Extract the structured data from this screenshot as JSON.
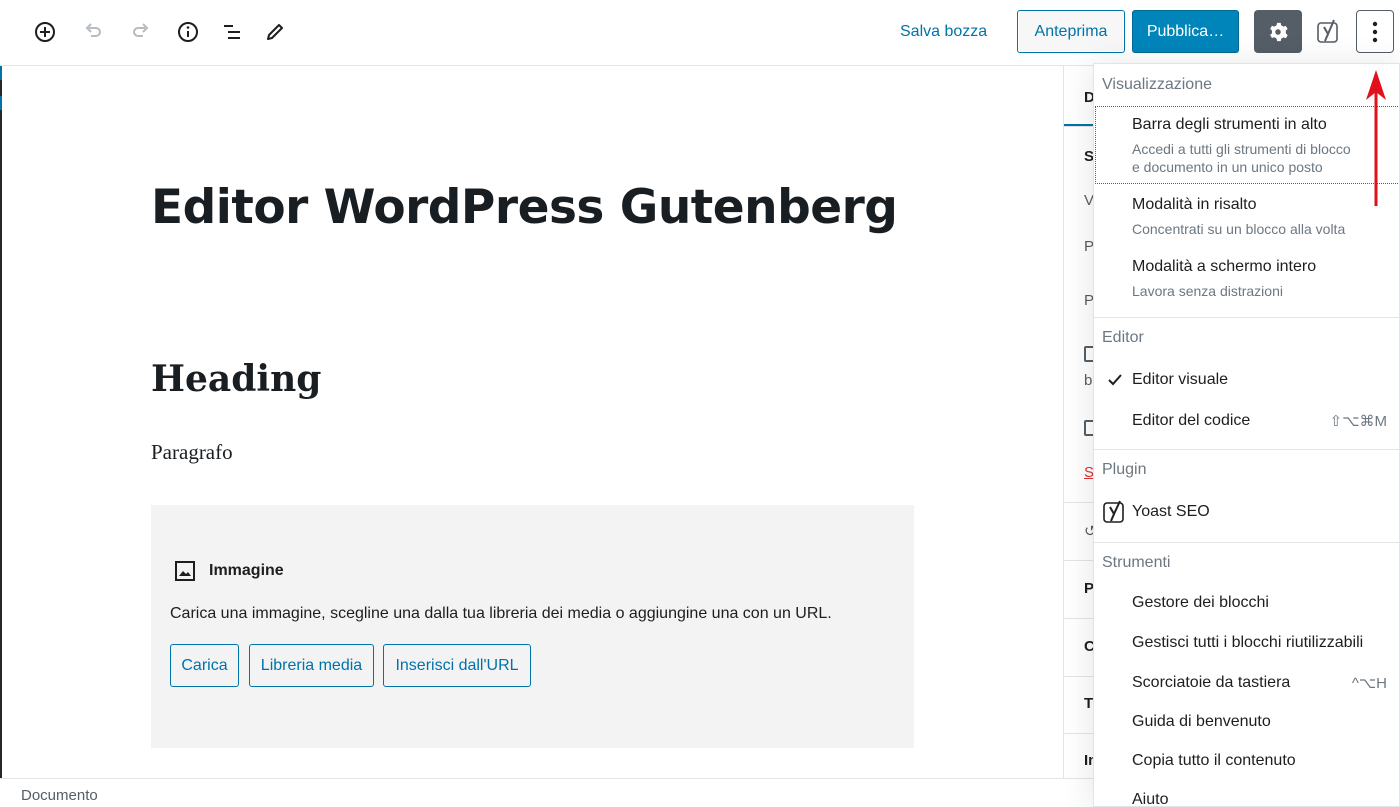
{
  "toolbar": {
    "save_draft": "Salva bozza",
    "preview": "Anteprima",
    "publish": "Pubblica…",
    "icons": [
      "add-block-icon",
      "undo-icon",
      "redo-icon",
      "info-icon",
      "block-navigation-icon",
      "edit-icon",
      "gear-icon",
      "yoast-icon",
      "more-vertical-icon"
    ]
  },
  "post": {
    "title": "Editor WordPress Gutenberg",
    "heading": "Heading",
    "paragraph": "Paragrafo",
    "image_block": {
      "label": "Immagine",
      "instructions": "Carica una immagine, scegline una dalla tua libreria dei media o aggiungine una con un URL.",
      "buttons": [
        "Carica",
        "Libreria media",
        "Inserisci dall'URL"
      ]
    }
  },
  "sidebar": {
    "fragments": [
      "D",
      "S",
      "V",
      "P",
      "P",
      "b",
      "S",
      "P",
      "C",
      "T",
      "Im"
    ]
  },
  "menu": {
    "view_title": "Visualizzazione",
    "view_items": [
      {
        "label": "Barra degli strumenti in alto",
        "desc1": "Accedi a tutti gli strumenti di blocco",
        "desc2": "e documento in un unico posto"
      },
      {
        "label": "Modalità in risalto",
        "desc1": "Concentrati su un blocco alla volta"
      },
      {
        "label": "Modalità a schermo intero",
        "desc1": "Lavora senza distrazioni"
      }
    ],
    "editor_title": "Editor",
    "editor_items": [
      {
        "label": "Editor visuale",
        "checked": true
      },
      {
        "label": "Editor del codice",
        "shortcut": "⇧⌥⌘M"
      }
    ],
    "plugin_title": "Plugin",
    "plugin_items": [
      {
        "label": "Yoast SEO"
      }
    ],
    "tools_title": "Strumenti",
    "tools_items": [
      {
        "label": "Gestore dei blocchi"
      },
      {
        "label": "Gestisci tutti i blocchi riutilizzabili"
      },
      {
        "label": "Scorciatoie da tastiera",
        "shortcut": "^⌥H"
      },
      {
        "label": "Guida di benvenuto"
      },
      {
        "label": "Copia tutto il contenuto"
      },
      {
        "label": "Aiuto"
      }
    ]
  },
  "statusbar": {
    "label": "Documento"
  },
  "colors": {
    "accent": "#0073aa",
    "publish": "#0085ba",
    "arrow": "#e2101a"
  }
}
